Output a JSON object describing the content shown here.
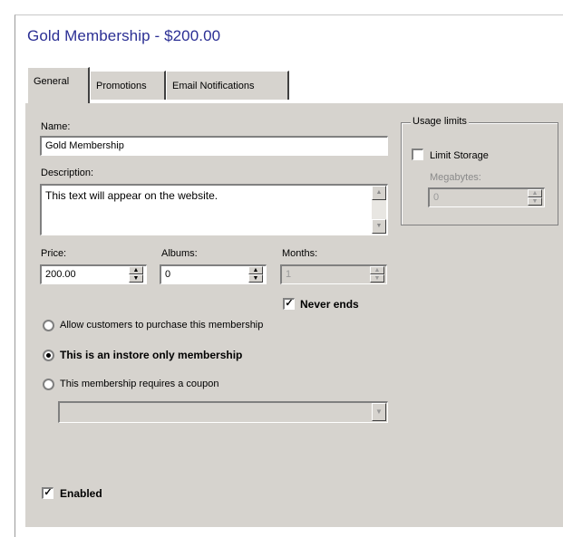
{
  "header": {
    "title": "Gold Membership - $200.00"
  },
  "tabs": [
    {
      "label": "General"
    },
    {
      "label": "Promotions"
    },
    {
      "label": "Email Notifications"
    }
  ],
  "general": {
    "name_label": "Name:",
    "name_value": "Gold Membership",
    "description_label": "Description:",
    "description_value": "This text will appear on the website.",
    "price_label": "Price:",
    "price_value": "200.00",
    "albums_label": "Albums:",
    "albums_value": "0",
    "months_label": "Months:",
    "months_value": "1",
    "never_ends_label": "Never ends",
    "never_ends_checked": true,
    "radio_allow": "Allow customers to purchase this membership",
    "radio_instore": "This is an instore only membership",
    "radio_coupon": "This membership requires a coupon",
    "selected_option": "instore",
    "coupon_value": "",
    "enabled_label": "Enabled",
    "enabled_checked": true
  },
  "usage_limits": {
    "title": "Usage limits",
    "limit_storage_label": "Limit Storage",
    "limit_storage_checked": false,
    "megabytes_label": "Megabytes:",
    "megabytes_value": "0"
  },
  "icons": {
    "spin_up": "▲",
    "spin_down": "▼",
    "check": "✓",
    "dropdown": "▼"
  }
}
